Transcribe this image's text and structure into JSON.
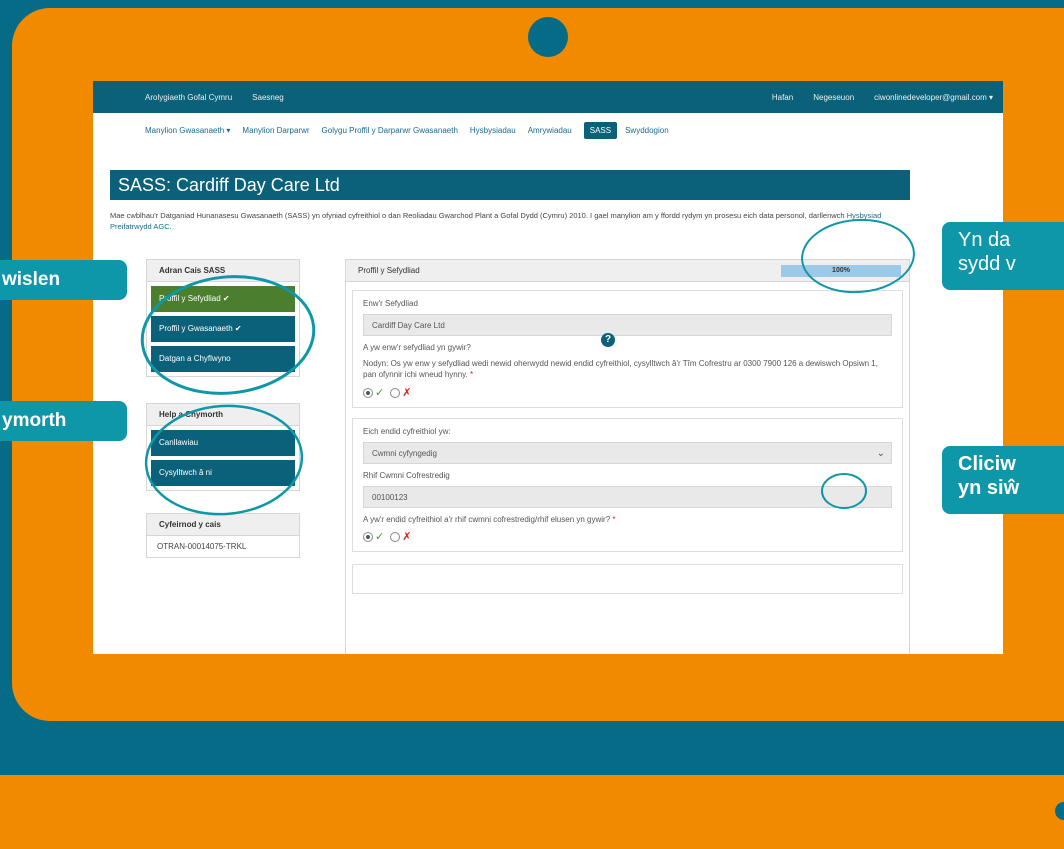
{
  "topbar": {
    "org": "Arolygiaeth Gofal Cymru",
    "language": "Saesneg",
    "home": "Hafan",
    "messages": "Negeseuon",
    "user": "ciwonlinedeveloper@gmail.com ▾"
  },
  "nav": {
    "items": [
      "Manylion Gwasanaeth ▾",
      "Manylion Darparwr",
      "Golygu Proffil y Darparwr Gwasanaeth",
      "Hysbysiadau",
      "Amrywiadau",
      "SASS",
      "Swyddogion"
    ],
    "active": "SASS"
  },
  "page": {
    "title": "SASS: Cardiff Day Care Ltd",
    "intro_text": "Mae cwblhau'r Datganiad Hunanasesu Gwasanaeth (SASS) yn ofyniad cyfreithiol o dan Reoliadau Gwarchod Plant a Gofal Dydd (Cymru) 2010. I gael manylion am y ffordd rydym yn prosesu eich data personol, darllenwch",
    "intro_link": "Hysbysiad Preifatrwydd AGC."
  },
  "sidebar": {
    "section_title": "Adran Cais SASS",
    "section_items": [
      "Proffil y Sefydliad ✔",
      "Proffil y Gwasanaeth ✔",
      "Datgan a Chyflwyno"
    ],
    "help_title": "Help a Chymorth",
    "help_items": [
      "Canllawiau",
      "Cysylltwch â ni"
    ],
    "ref_title": "Cyfeirnod y cais",
    "ref_value": "OTRAN-00014075-TRKL"
  },
  "main": {
    "header": "Proffil y Sefydliad",
    "progress_label": "100%",
    "progress_value": 1.0,
    "org_name_label": "Enw'r Sefydliad",
    "org_name_value": "Cardiff Day Care Ltd",
    "org_name_question": "A yw enw'r sefydliad yn gywir?",
    "note": "Nodyn: Os yw enw y sefydliad wedi newid oherwydd newid endid cyfreithiol, cysylltwch â'r Tîm Cofrestru ar 0300 7900 126 a dewiswch Opsiwn 1, pan ofynnir ichi wneud hynny.",
    "required_mark": "*",
    "legal_entity_label": "Eich endid cyfreithiol yw:",
    "legal_entity_value": "Cwmni cyfyngedig",
    "company_number_label": "Rhif Cwmni Cofrestredig",
    "company_number_value": "00100123",
    "company_question": "A yw'r endid cyfreithiol a'r rhif cwmni cofrestredig/rhif elusen yn gywir?",
    "help_icon": "?"
  },
  "overlay_tags": {
    "left1": "wislen",
    "left2": "ymorth",
    "right1_line1": "Yn da",
    "right1_line2": "sydd v",
    "right2_line1": "Cliciw",
    "right2_line2": "yn siŵ"
  },
  "colors": {
    "frame_teal": "#056b87",
    "frame_orange": "#f28a00",
    "header_teal": "#0b6179",
    "tag_teal": "#0e97a8",
    "active_green": "#4b7f2e"
  }
}
